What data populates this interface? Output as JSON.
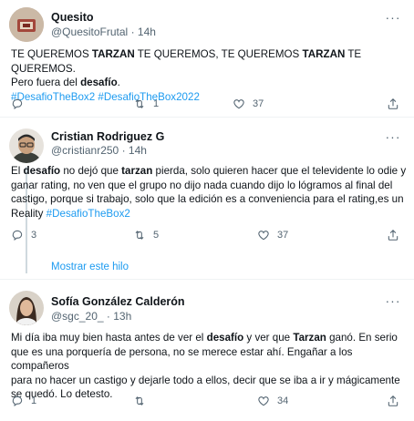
{
  "tweets": [
    {
      "name": "Quesito",
      "handle": "@QuesitoFrutal",
      "sep": "·",
      "time": "14h",
      "lines": [
        [
          {
            "t": "TE QUEREMOS ",
            "s": "text"
          },
          {
            "t": "TARZAN",
            "s": "bold"
          },
          {
            "t": " TE QUEREMOS, TE QUEREMOS ",
            "s": "text"
          },
          {
            "t": "TARZAN",
            "s": "bold"
          },
          {
            "t": " TE QUEREMOS.",
            "s": "text"
          }
        ],
        [
          {
            "t": "Pero fuera del ",
            "s": "text"
          },
          {
            "t": "desafío",
            "s": "bold"
          },
          {
            "t": ".",
            "s": "text"
          }
        ],
        [
          {
            "t": "#DesafioTheBox2 #DesafioTheBox2022",
            "s": "tag"
          }
        ]
      ],
      "replies": "",
      "retweets": "1",
      "likes": "37"
    },
    {
      "name": "Cristian Rodriguez G",
      "handle": "@cristianr250",
      "sep": "·",
      "time": "14h",
      "lines": [
        [
          {
            "t": "El ",
            "s": "text"
          },
          {
            "t": "desafío",
            "s": "bold"
          },
          {
            "t": " no dejó que ",
            "s": "text"
          },
          {
            "t": "tarzan",
            "s": "bold"
          },
          {
            "t": " pierda, solo quieren hacer que el televidente lo odie y",
            "s": "text"
          }
        ],
        [
          {
            "t": "ganar rating, no ven que el grupo no dijo nada cuando dijo lo lógramos al final del",
            "s": "text"
          }
        ],
        [
          {
            "t": "castigo, porque si trabajo, solo que la edición es a conveniencia para el rating,es un",
            "s": "text"
          }
        ],
        [
          {
            "t": "Reality ",
            "s": "text"
          },
          {
            "t": "#DesafioTheBox2",
            "s": "tag"
          }
        ]
      ],
      "replies": "3",
      "retweets": "5",
      "likes": "37"
    },
    {
      "name": "Sofía González Calderón",
      "handle": "@sgc_20_",
      "sep": "·",
      "time": "13h",
      "lines": [
        [
          {
            "t": "Mi día iba muy bien hasta antes de ver el ",
            "s": "text"
          },
          {
            "t": "desafío",
            "s": "bold"
          },
          {
            "t": " y ver que ",
            "s": "text"
          },
          {
            "t": "Tarzan",
            "s": "bold"
          },
          {
            "t": " ganó. En serio",
            "s": "text"
          }
        ],
        [
          {
            "t": "que es una porquería de persona, no se merece estar ahí. Engañar a los compañeros",
            "s": "text"
          }
        ],
        [
          {
            "t": "para no hacer un castigo y dejarle todo a ellos, decir que se iba a ir y mágicamente",
            "s": "text"
          }
        ],
        [
          {
            "t": "se quedó. Lo detesto.",
            "s": "text"
          }
        ]
      ],
      "replies": "1",
      "retweets": "",
      "likes": "34"
    }
  ],
  "show_thread": "Mostrar este hilo",
  "icons": {
    "reply": "reply-icon",
    "retweet": "retweet-icon",
    "like": "like-icon",
    "share": "share-icon",
    "more": "more-icon"
  },
  "colors": {
    "text": "#0f1419",
    "secondary": "#536471",
    "link": "#1d9bf0",
    "divider": "#eff3f4"
  }
}
